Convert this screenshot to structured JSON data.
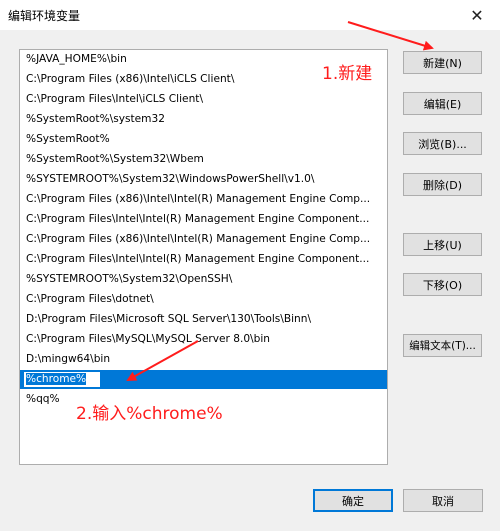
{
  "window": {
    "title": "编辑环境变量",
    "close_glyph": "✕"
  },
  "path_list": {
    "rows": [
      "%JAVA_HOME%\\bin",
      "C:\\Program Files (x86)\\Intel\\iCLS Client\\",
      "C:\\Program Files\\Intel\\iCLS Client\\",
      "%SystemRoot%\\system32",
      "%SystemRoot%",
      "%SystemRoot%\\System32\\Wbem",
      "%SYSTEMROOT%\\System32\\WindowsPowerShell\\v1.0\\",
      "C:\\Program Files (x86)\\Intel\\Intel(R) Management Engine Comp...",
      "C:\\Program Files\\Intel\\Intel(R) Management Engine Component...",
      "C:\\Program Files (x86)\\Intel\\Intel(R) Management Engine Comp...",
      "C:\\Program Files\\Intel\\Intel(R) Management Engine Component...",
      "%SYSTEMROOT%\\System32\\OpenSSH\\",
      "C:\\Program Files\\dotnet\\",
      "D:\\Program Files\\Microsoft SQL Server\\130\\Tools\\Binn\\",
      "C:\\Program Files\\MySQL\\MySQL Server 8.0\\bin",
      "D:\\mingw64\\bin"
    ],
    "editing_value": "%chrome%",
    "last_row": "%qq%"
  },
  "buttons": {
    "new": "新建(N)",
    "edit": "编辑(E)",
    "browse": "浏览(B)...",
    "delete": "删除(D)",
    "move_up": "上移(U)",
    "move_down": "下移(O)",
    "edit_text": "编辑文本(T)...",
    "ok": "确定",
    "cancel": "取消"
  },
  "annotations": {
    "step1": "1.新建",
    "step2": "2.输入%chrome%"
  },
  "colors": {
    "selection": "#0078d7",
    "annotation": "#ff1c1c"
  }
}
